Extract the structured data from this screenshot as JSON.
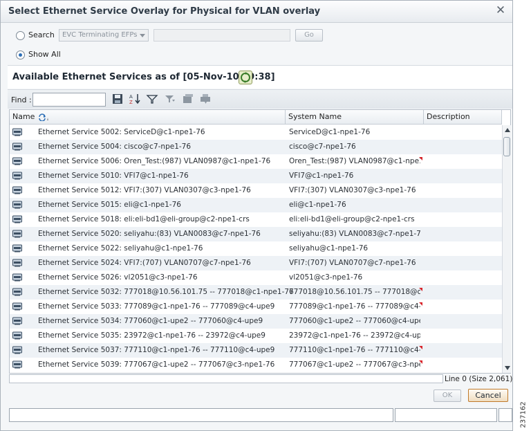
{
  "window": {
    "title": "Select Ethernet Service Overlay for Physical for VLAN overlay",
    "close_glyph": "✕"
  },
  "search": {
    "search_label": "Search",
    "search_selected": false,
    "combo_value": "EVC Terminating EFPs",
    "text_value": "",
    "go_label": "Go",
    "show_all_label": "Show All",
    "show_all_selected": true
  },
  "services": {
    "title": "Available Ethernet Services as of [05-Nov-10 09:38]",
    "refresh_icon": "refresh-icon"
  },
  "toolbar": {
    "find_label": "Find :",
    "find_value": "",
    "icons": [
      "save-icon",
      "sort-az-icon",
      "filter-icon",
      "advanced-filter-icon",
      "export-icon",
      "print-icon"
    ]
  },
  "grid": {
    "columns": [
      "Name",
      "System Name",
      "Description"
    ],
    "rows": [
      {
        "name": "Ethernet Service 5002: ServiceD@c1-npe1-76",
        "system_name": "ServiceD@c1-npe1-76",
        "truncated": false
      },
      {
        "name": "Ethernet Service 5004: cisco@c7-npe1-76",
        "system_name": "cisco@c7-npe1-76",
        "truncated": false
      },
      {
        "name": "Ethernet Service 5006: Oren_Test:(987) VLAN0987@c1-npe1-76",
        "system_name": "Oren_Test:(987) VLAN0987@c1-npe1...",
        "truncated": true
      },
      {
        "name": "Ethernet Service 5010: VFI7@c1-npe1-76",
        "system_name": "VFI7@c1-npe1-76",
        "truncated": false
      },
      {
        "name": "Ethernet Service 5012: VFI7:(307) VLAN0307@c3-npe1-76",
        "system_name": "VFI7:(307) VLAN0307@c3-npe1-76",
        "truncated": false
      },
      {
        "name": "Ethernet Service 5015: eli@c1-npe1-76",
        "system_name": "eli@c1-npe1-76",
        "truncated": false
      },
      {
        "name": "Ethernet Service 5018: eli:eli-bd1@eli-group@c2-npe1-crs",
        "system_name": "eli:eli-bd1@eli-group@c2-npe1-crs",
        "truncated": false
      },
      {
        "name": "Ethernet Service 5020: seliyahu:(83) VLAN0083@c7-npe1-76",
        "system_name": "seliyahu:(83) VLAN0083@c7-npe1-76",
        "truncated": false
      },
      {
        "name": "Ethernet Service 5022: seliyahu@c1-npe1-76",
        "system_name": "seliyahu@c1-npe1-76",
        "truncated": false
      },
      {
        "name": "Ethernet Service 5024: VFI7:(707) VLAN0707@c7-npe1-76",
        "system_name": "VFI7:(707) VLAN0707@c7-npe1-76",
        "truncated": false
      },
      {
        "name": "Ethernet Service 5026: vl2051@c3-npe1-76",
        "system_name": "vl2051@c3-npe1-76",
        "truncated": false
      },
      {
        "name": "Ethernet Service 5032: 777018@10.56.101.75 -- 777018@c1-npe1-76",
        "system_name": "777018@10.56.101.75 -- 777018@c1...",
        "truncated": true
      },
      {
        "name": "Ethernet Service 5033: 777089@c1-npe1-76 -- 777089@c4-upe9",
        "system_name": "777089@c1-npe1-76 -- 777089@c4-u...",
        "truncated": true
      },
      {
        "name": "Ethernet Service 5034: 777060@c1-upe2 -- 777060@c4-upe9",
        "system_name": "777060@c1-upe2 -- 777060@c4-upe9",
        "truncated": false
      },
      {
        "name": "Ethernet Service 5035: 23972@c1-npe1-76 -- 23972@c4-upe9",
        "system_name": "23972@c1-npe1-76 -- 23972@c4-upe9",
        "truncated": false
      },
      {
        "name": "Ethernet Service 5037: 777110@c1-npe1-76 -- 777110@c4-upe9",
        "system_name": "777110@c1-npe1-76 -- 777110@c4-u...",
        "truncated": true
      },
      {
        "name": "Ethernet Service 5039: 777067@c1-upe2 -- 777067@c3-npe1-76",
        "system_name": "777067@c1-upe2 -- 777067@c3-npe...",
        "truncated": true
      }
    ],
    "line_info": "Line 0 (Size 2,061)"
  },
  "footer": {
    "ok_label": "OK",
    "cancel_label": "Cancel"
  },
  "side_label": "237162",
  "colors": {
    "accent_blue": "#2d6fb7",
    "truncation_marker": "#d8242a",
    "cancel_border": "#c07a2a"
  }
}
